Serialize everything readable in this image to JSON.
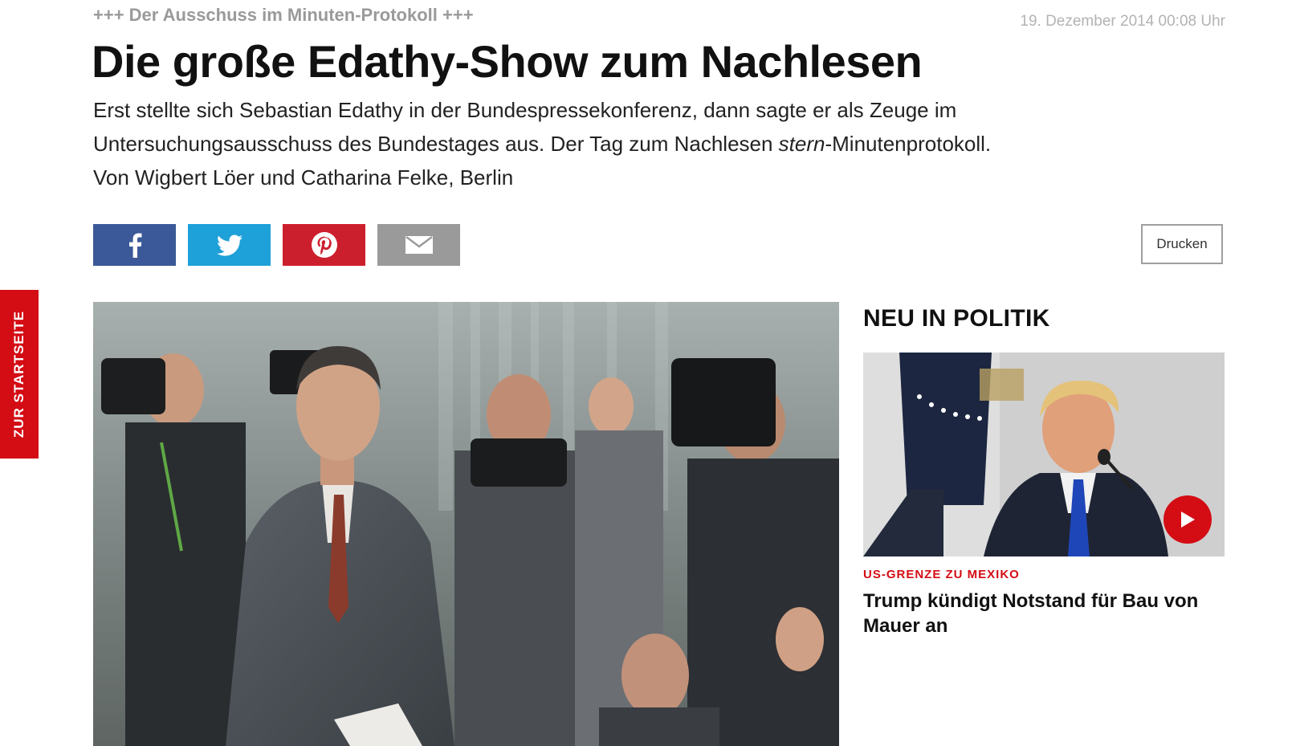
{
  "side_tab": {
    "label": "ZUR STARTSEITE"
  },
  "article": {
    "kicker": "+++ Der Ausschuss im Minuten-Protokoll +++",
    "date": "19. Dezember 2014 00:08 Uhr",
    "headline": "Die große Edathy-Show zum Nachlesen",
    "intro_part1": "Erst stellte sich Sebastian Edathy in der Bundespressekonferenz, dann sagte er als Zeuge im Untersuchungsausschuss des Bundestages aus. Der Tag zum Nachlesen ",
    "intro_em": "stern",
    "intro_part2": "-Minutenprotokoll.",
    "byline": "Von Wigbert Löer und Catharina Felke, Berlin"
  },
  "share": {
    "icons": [
      "facebook-icon",
      "twitter-icon",
      "pinterest-icon",
      "mail-icon"
    ],
    "colors": {
      "facebook": "#3b5998",
      "twitter": "#1ea0d8",
      "pinterest": "#cc1f2d",
      "mail": "#9a9a9a"
    },
    "print_label": "Drucken"
  },
  "sidebar": {
    "title": "NEU IN POLITIK",
    "teaser": {
      "kicker": "US-GRENZE ZU MEXIKO",
      "title": "Trump kündigt Notstand für Bau von Mauer an",
      "play_icon": "play-icon"
    }
  },
  "colors": {
    "accent": "#d40c14",
    "kicker_gray": "#9a9a9a"
  }
}
